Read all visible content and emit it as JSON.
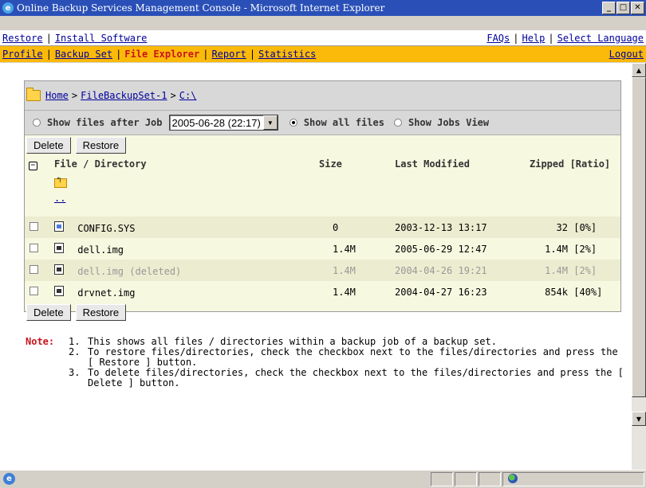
{
  "window": {
    "title": "Online Backup Services Management Console - Microsoft Internet Explorer",
    "min_label": "_",
    "max_label": "□",
    "close_label": "✕"
  },
  "nav_top": {
    "left": [
      "Restore",
      "Install Software"
    ],
    "right": [
      "FAQs",
      "Help",
      "Select Language"
    ]
  },
  "nav_main": {
    "items": [
      "Profile",
      "Backup Set",
      "File Explorer",
      "Report",
      "Statistics"
    ],
    "active": "File Explorer",
    "logout": "Logout"
  },
  "breadcrumb": {
    "home": "Home",
    "backup_set": "FileBackupSet-1",
    "drive": "C:\\",
    "separator": ">"
  },
  "filter": {
    "show_after_job_label": "Show files after Job",
    "job_value": "2005-06-28 (22:17)",
    "show_all_label": "Show all files",
    "show_jobs_label": "Show Jobs View",
    "selected": "show_all"
  },
  "buttons": {
    "delete": "Delete",
    "restore": "Restore"
  },
  "table": {
    "columns": [
      "File / Directory",
      "Size",
      "Last Modified",
      "Zipped [Ratio]"
    ],
    "parent_label": "..",
    "rows": [
      {
        "name": "CONFIG.SYS",
        "size": "0",
        "modified": "2003-12-13 13:17",
        "zipped": "32",
        "ratio": "[0%]",
        "icon": "system-file-icon",
        "deleted": false
      },
      {
        "name": "dell.img",
        "size": "1.4M",
        "modified": "2005-06-29 12:47",
        "zipped": "1.4M",
        "ratio": "[2%]",
        "icon": "image-file-icon",
        "deleted": false
      },
      {
        "name": "dell.img (deleted)",
        "size": "1.4M",
        "modified": "2004-04-26 19:21",
        "zipped": "1.4M",
        "ratio": "[2%]",
        "icon": "image-file-icon",
        "deleted": true
      },
      {
        "name": "drvnet.img",
        "size": "1.4M",
        "modified": "2004-04-27 16:23",
        "zipped": "854k",
        "ratio": "[40%]",
        "icon": "image-file-icon",
        "deleted": false
      }
    ]
  },
  "note": {
    "label": "Note:",
    "items": [
      {
        "num": "1.",
        "text": "This shows all files / directories within a backup job of a backup set."
      },
      {
        "num": "2.",
        "text": "To restore files/directories, check the checkbox next to the files/directories and press the [ Restore ] button."
      },
      {
        "num": "3.",
        "text": "To delete files/directories, check the checkbox next to the files/directories and press the [ Delete ] button."
      }
    ]
  }
}
